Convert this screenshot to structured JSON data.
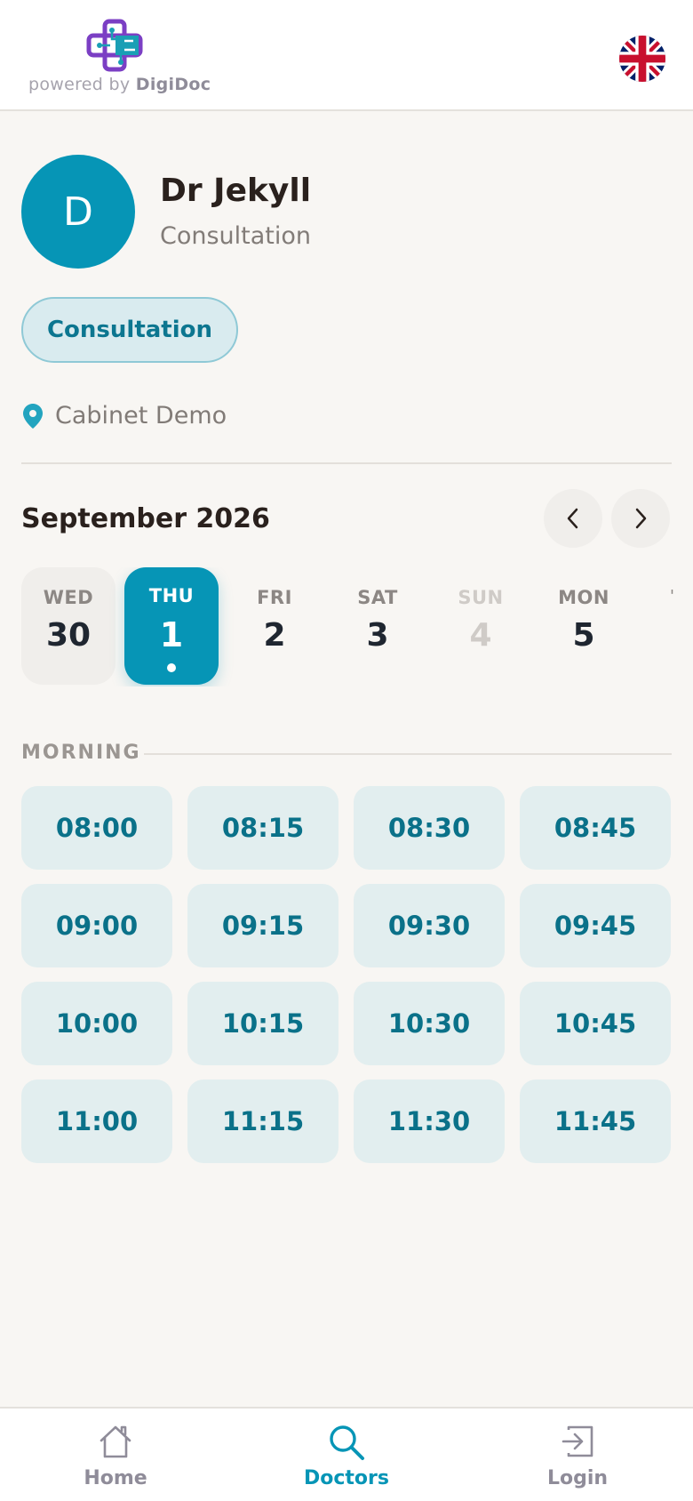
{
  "header": {
    "powered_prefix": "powered by",
    "brand": "DigiDoc",
    "language_icon": "uk-flag-icon"
  },
  "doctor": {
    "initial": "D",
    "name": "Dr Jekyll",
    "specialty": "Consultation",
    "service_pill": "Consultation",
    "location": "Cabinet Demo"
  },
  "calendar": {
    "month_label": "September 2026",
    "prev_icon": "chevron-left-icon",
    "next_icon": "chevron-right-icon",
    "days": [
      {
        "dow": "WED",
        "num": "30",
        "state": "past"
      },
      {
        "dow": "THU",
        "num": "1",
        "state": "selected"
      },
      {
        "dow": "FRI",
        "num": "2",
        "state": "normal"
      },
      {
        "dow": "SAT",
        "num": "3",
        "state": "normal"
      },
      {
        "dow": "SUN",
        "num": "4",
        "state": "disabled"
      },
      {
        "dow": "MON",
        "num": "5",
        "state": "normal"
      }
    ],
    "more_indicator": "'"
  },
  "slots": {
    "section_label": "MORNING",
    "times": [
      "08:00",
      "08:15",
      "08:30",
      "08:45",
      "09:00",
      "09:15",
      "09:30",
      "09:45",
      "10:00",
      "10:15",
      "10:30",
      "10:45",
      "11:00",
      "11:15",
      "11:30",
      "11:45"
    ]
  },
  "bottom_nav": {
    "items": [
      {
        "label": "Home",
        "icon": "home-icon",
        "active": false
      },
      {
        "label": "Doctors",
        "icon": "search-icon",
        "active": true
      },
      {
        "label": "Login",
        "icon": "login-icon",
        "active": false
      }
    ]
  },
  "colors": {
    "primary": "#0695b6",
    "slot_bg": "#e2eeef",
    "slot_text": "#0a7189",
    "page_bg": "#f8f6f3"
  }
}
